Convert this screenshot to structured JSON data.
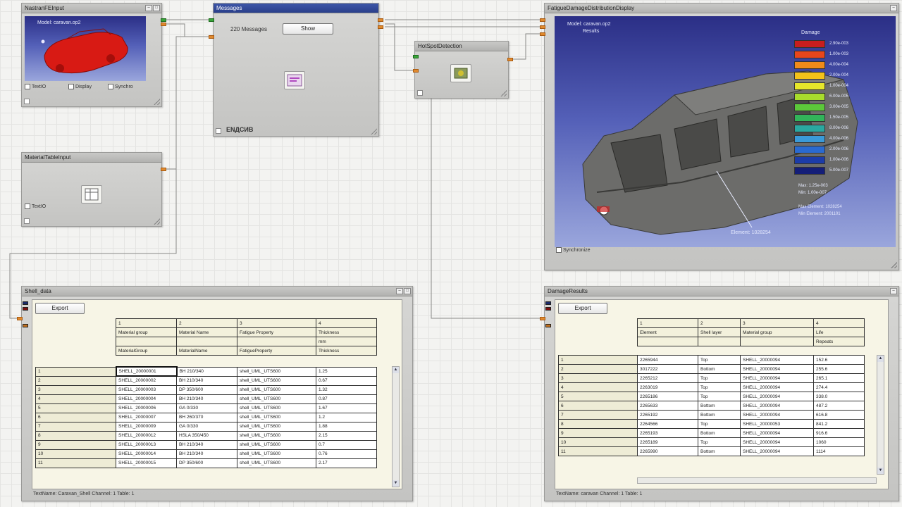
{
  "nodes": {
    "mesh_input": {
      "title": "NastranFEInput",
      "model_text": "Model: caravan.op2",
      "footer": [
        "TextIO",
        "Display",
        "Synchro"
      ]
    },
    "messages": {
      "title": "Messages",
      "count_label": "220 Messages",
      "show_button": "Show",
      "footer_text": "ENДСИВ"
    },
    "hotspot": {
      "title": "HotSpotDetection"
    },
    "material": {
      "title": "MaterialTableInput",
      "footer": "TextIO"
    },
    "fatigue_display": {
      "title": "FatigueDamageDistributionDisplay",
      "model_text": "Model: caravan.op2",
      "sub_text": "Results",
      "legend_title": "Damage",
      "legend_values": [
        "2.90e-003",
        "1.00e-003",
        "4.00e-004",
        "2.00e-004",
        "1.00e-004",
        "6.00e-005",
        "3.00e-005",
        "1.50e-005",
        "8.00e-006",
        "4.00e-006",
        "2.00e-006",
        "1.00e-006",
        "5.00e-007"
      ],
      "legend_colors": [
        "#c81e1e",
        "#e8461c",
        "#f08a1a",
        "#f3c21a",
        "#e6e62a",
        "#a8dc2c",
        "#5cc83a",
        "#32b45a",
        "#2aa8a0",
        "#3a9ad8",
        "#2a6ad0",
        "#1c3ca8",
        "#141e78"
      ],
      "stats": [
        "Max: 1.25e-003",
        "Min: 1.00e-007",
        "Max Element: 1028254"
      ],
      "stats2": [
        "Min Element: 2001101"
      ],
      "callout": "Element: 1028254",
      "footer": "Synchronize"
    },
    "shell_data": {
      "title": "Shell_data",
      "export_button": "Export",
      "columns": [
        "1",
        "2",
        "3",
        "4"
      ],
      "header_rows": [
        [
          "Material group",
          "Material Name",
          "Fatigue Property",
          "Thickness"
        ],
        [
          "",
          "",
          "",
          "mm"
        ],
        [
          "MaterialGroup",
          "MaterialName",
          "FatigueProperty",
          "Thickness"
        ]
      ],
      "row_labels": [
        "1",
        "2",
        "3",
        "4",
        "5",
        "6",
        "7",
        "8",
        "9",
        "10",
        "11"
      ],
      "rows": [
        [
          "SHELL_20000001",
          "BH 210/340",
          "shell_UML_UTS600",
          "1.25"
        ],
        [
          "SHELL_20000002",
          "BH 210/340",
          "shell_UML_UTS600",
          "0.67"
        ],
        [
          "SHELL_20000003",
          "DP 350/600",
          "shell_UML_UTS600",
          "1.32"
        ],
        [
          "SHELL_20000004",
          "BH 210/340",
          "shell_UML_UTS600",
          "0.87"
        ],
        [
          "SHELL_20000006",
          "GA 0/330",
          "shell_UML_UTS600",
          "1.67"
        ],
        [
          "SHELL_20000007",
          "BH 260/370",
          "shell_UML_UTS600",
          "1.2"
        ],
        [
          "SHELL_20000009",
          "GA 0/330",
          "shell_UML_UTS600",
          "1.88"
        ],
        [
          "SHELL_20000012",
          "HSLA 350/450",
          "shell_UML_UTS600",
          "2.15"
        ],
        [
          "SHELL_20000013",
          "BH 210/340",
          "shell_UML_UTS600",
          "0.7"
        ],
        [
          "SHELL_20000014",
          "BH 210/340",
          "shell_UML_UTS600",
          "0.76"
        ],
        [
          "SHELL_20000015",
          "DP 350/600",
          "shell_UML_UTS600",
          "2.17"
        ]
      ],
      "status": "TextName: Caravan_Shell   Channel: 1   Table: 1"
    },
    "damage_results": {
      "title": "DamageResults",
      "export_button": "Export",
      "columns": [
        "1",
        "2",
        "3",
        "4"
      ],
      "header_rows": [
        [
          "Element",
          "Shell layer",
          "Material group",
          "Life"
        ],
        [
          "",
          "",
          "",
          "Repeats"
        ]
      ],
      "row_labels": [
        "1",
        "2",
        "3",
        "4",
        "5",
        "6",
        "7",
        "8",
        "9",
        "10",
        "11"
      ],
      "rows": [
        [
          "2265944",
          "Top",
          "SHELL_20000094",
          "152.6"
        ],
        [
          "3017222",
          "Bottom",
          "SHELL_20000094",
          "255.6"
        ],
        [
          "2265212",
          "Top",
          "SHELL_20000094",
          "265.1"
        ],
        [
          "2263019",
          "Top",
          "SHELL_20000094",
          "274.4"
        ],
        [
          "2265186",
          "Top",
          "SHELL_20000094",
          "338.0"
        ],
        [
          "2265633",
          "Bottom",
          "SHELL_20000094",
          "487.2"
        ],
        [
          "2265192",
          "Bottom",
          "SHELL_20000094",
          "616.8"
        ],
        [
          "2264566",
          "Top",
          "SHELL_20000053",
          "841.2"
        ],
        [
          "2265193",
          "Bottom",
          "SHELL_20000094",
          "916.6"
        ],
        [
          "2265189",
          "Top",
          "SHELL_20000094",
          "1060"
        ],
        [
          "2265990",
          "Bottom",
          "SHELL_20000094",
          "1114"
        ]
      ],
      "status": "TextName: caravan   Channel: 1   Table: 1"
    }
  }
}
